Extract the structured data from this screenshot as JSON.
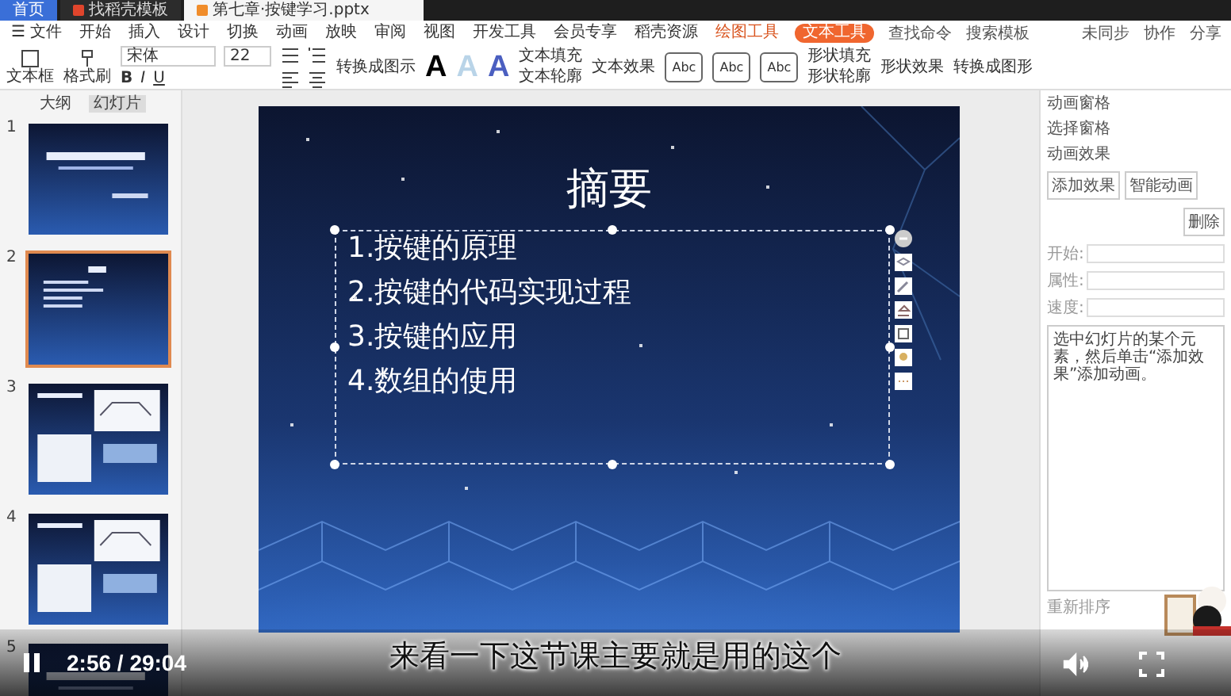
{
  "browser_tabs": [
    {
      "label": "首页",
      "selected": false,
      "kind": "home"
    },
    {
      "label": "找稻壳模板",
      "selected": false,
      "kind": "docer"
    },
    {
      "label": "第七章·按键学习.pptx",
      "selected": true,
      "kind": "ppt"
    }
  ],
  "menu": {
    "menu_icon": "☰",
    "file": "文件",
    "tabs": [
      {
        "label": "开始",
        "selected": false
      },
      {
        "label": "插入",
        "selected": false
      },
      {
        "label": "设计",
        "selected": false
      },
      {
        "label": "切换",
        "selected": false
      },
      {
        "label": "动画",
        "selected": false
      },
      {
        "label": "放映",
        "selected": false
      },
      {
        "label": "审阅",
        "selected": false
      },
      {
        "label": "视图",
        "selected": false
      },
      {
        "label": "开发工具",
        "selected": false
      },
      {
        "label": "会员专享",
        "selected": false
      },
      {
        "label": "稻壳资源",
        "selected": false
      }
    ],
    "context_tabs": [
      {
        "label": "绘图工具",
        "selected": false
      },
      {
        "label": "文本工具",
        "selected": true
      }
    ],
    "search": "查找命令",
    "search_2": "搜索模板",
    "actions": [
      "未同步",
      "协作",
      "分享"
    ]
  },
  "toolbar": {
    "text_box": "文本框",
    "format_painter": "格式刷",
    "font": "宋体",
    "size": "22",
    "format": [
      "B",
      "I",
      "U"
    ],
    "presets": [
      {
        "letter": "A",
        "color": "#000000"
      },
      {
        "letter": "A",
        "color": "#b9d4e8"
      },
      {
        "letter": "A",
        "color": "#4b5fc0"
      }
    ],
    "convert": "转换成图示",
    "text_fill": "文本填充",
    "text_outline": "文本轮廓",
    "text_effects": "文本效果",
    "styles": [
      "Abc",
      "Abc",
      "Abc"
    ],
    "shape_fill": "形状填充",
    "shape_outline": "形状轮廓",
    "shape_effects": "形状效果",
    "arrange": "转换成图形"
  },
  "panel_tabs": [
    {
      "label": "大纲",
      "selected": false
    },
    {
      "label": "幻灯片",
      "selected": true
    }
  ],
  "thumbnails": [
    {
      "number": "1",
      "selected": false,
      "kind": "title"
    },
    {
      "number": "2",
      "selected": true,
      "kind": "list"
    },
    {
      "number": "3",
      "selected": false,
      "kind": "figures"
    },
    {
      "number": "4",
      "selected": false,
      "kind": "figures"
    },
    {
      "number": "5",
      "selected": false,
      "kind": "title"
    }
  ],
  "slide": {
    "title": "摘要",
    "items": [
      "1.按键的原理",
      "2.按键的代码实现过程",
      "3.按键的应用",
      "4.数组的使用"
    ]
  },
  "animation_pane": {
    "title": "动画窗格",
    "select": "选择窗格",
    "section": "动画效果",
    "add": "添加效果",
    "smart": "智能动画",
    "delete": "删除",
    "fields": [
      {
        "label": "开始:"
      },
      {
        "label": "属性:"
      },
      {
        "label": "速度:"
      }
    ],
    "hint": "选中幻灯片的某个元素，然后单击“添加效果”添加动画。",
    "reorder": "重新排序"
  },
  "player": {
    "playing": true,
    "time": "2:56 / 29:04",
    "subtitle": "来看一下这节课主要就是用的这个"
  }
}
